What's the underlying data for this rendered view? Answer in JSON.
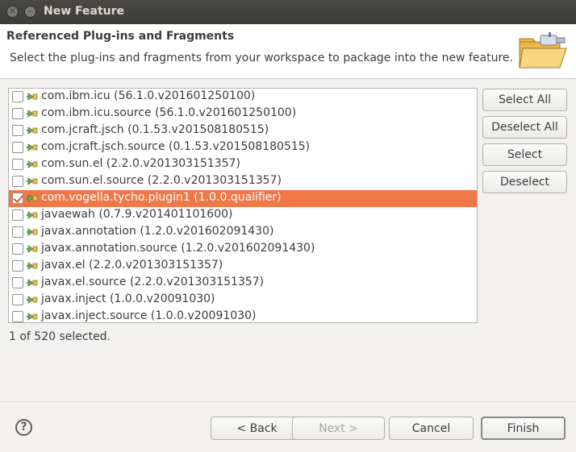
{
  "window": {
    "title": "New Feature"
  },
  "header": {
    "title": "Referenced Plug-ins and Fragments",
    "description": "Select the plug-ins and fragments from your workspace to package into the new feature."
  },
  "plugins": [
    {
      "name": "com.ibm.icu",
      "version": "(56.1.0.v201601250100)",
      "checked": false,
      "selected": false
    },
    {
      "name": "com.ibm.icu.source",
      "version": "(56.1.0.v201601250100)",
      "checked": false,
      "selected": false
    },
    {
      "name": "com.jcraft.jsch",
      "version": "(0.1.53.v201508180515)",
      "checked": false,
      "selected": false
    },
    {
      "name": "com.jcraft.jsch.source",
      "version": "(0.1.53.v201508180515)",
      "checked": false,
      "selected": false
    },
    {
      "name": "com.sun.el",
      "version": "(2.2.0.v201303151357)",
      "checked": false,
      "selected": false
    },
    {
      "name": "com.sun.el.source",
      "version": "(2.2.0.v201303151357)",
      "checked": false,
      "selected": false
    },
    {
      "name": "com.vogella.tycho.plugin1",
      "version": "(1.0.0.qualifier)",
      "checked": true,
      "selected": true
    },
    {
      "name": "javaewah",
      "version": "(0.7.9.v201401101600)",
      "checked": false,
      "selected": false
    },
    {
      "name": "javax.annotation",
      "version": "(1.2.0.v201602091430)",
      "checked": false,
      "selected": false
    },
    {
      "name": "javax.annotation.source",
      "version": "(1.2.0.v201602091430)",
      "checked": false,
      "selected": false
    },
    {
      "name": "javax.el",
      "version": "(2.2.0.v201303151357)",
      "checked": false,
      "selected": false
    },
    {
      "name": "javax.el.source",
      "version": "(2.2.0.v201303151357)",
      "checked": false,
      "selected": false
    },
    {
      "name": "javax.inject",
      "version": "(1.0.0.v20091030)",
      "checked": false,
      "selected": false
    },
    {
      "name": "javax.inject.source",
      "version": "(1.0.0.v20091030)",
      "checked": false,
      "selected": false
    }
  ],
  "side_buttons": {
    "select_all": "Select All",
    "deselect_all": "Deselect All",
    "select": "Select",
    "deselect": "Deselect"
  },
  "status": "1 of 520 selected.",
  "footer": {
    "help": "?",
    "back": "< Back",
    "next": "Next >",
    "cancel": "Cancel",
    "finish": "Finish"
  },
  "colors": {
    "selection": "#f07746",
    "titlebar": "#3c3b37"
  },
  "icons": {
    "header": "folder-plugin-icon",
    "row": "plugin-icon",
    "help": "help-icon"
  }
}
